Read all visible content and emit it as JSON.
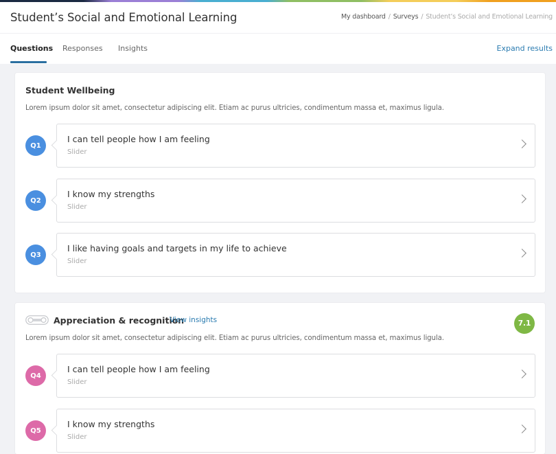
{
  "header": {
    "title": "Student’s Social and Emotional Learning",
    "breadcrumb": [
      {
        "label": "My dashboard",
        "current": false
      },
      {
        "label": "Surveys",
        "current": false
      },
      {
        "label": "Student’s Social and Emotional Learning",
        "current": true
      }
    ],
    "breadcrumb_separator": "/"
  },
  "tabs": [
    {
      "label": "Questions",
      "active": true
    },
    {
      "label": "Responses",
      "active": false
    },
    {
      "label": "Insights",
      "active": false
    }
  ],
  "expand_results_label": "Expand results",
  "colors": {
    "accent_blue": "#2a7bb0",
    "tab_underline": "#2a6fa0",
    "section1_badge": "#4a8fe0",
    "section2_badge": "#dd6aa8",
    "score_green": "#7fb845"
  },
  "sections": [
    {
      "title": "Student Wellbeing",
      "description": "Lorem ipsum dolor sit amet, consectetur adipiscing elit. Etiam ac purus ultricies, condimentum massa et, maximus ligula.",
      "questions": [
        {
          "badge": "Q1",
          "text": "I can tell people how I am feeling",
          "type": "Slider"
        },
        {
          "badge": "Q2",
          "text": "I know my strengths",
          "type": "Slider"
        },
        {
          "badge": "Q3",
          "text": "I like having goals and targets in my life to achieve",
          "type": "Slider"
        }
      ]
    },
    {
      "icon": "cassette-icon",
      "title": "Appreciation & recognition",
      "view_insights_label": "View insights",
      "score": "7.1",
      "description": "Lorem ipsum dolor sit amet, consectetur adipiscing elit. Etiam ac purus ultricies, condimentum massa et, maximus ligula.",
      "questions": [
        {
          "badge": "Q4",
          "text": "I can tell people how I am feeling",
          "type": "Slider"
        },
        {
          "badge": "Q5",
          "text": "I know my strengths",
          "type": "Slider"
        }
      ]
    }
  ]
}
